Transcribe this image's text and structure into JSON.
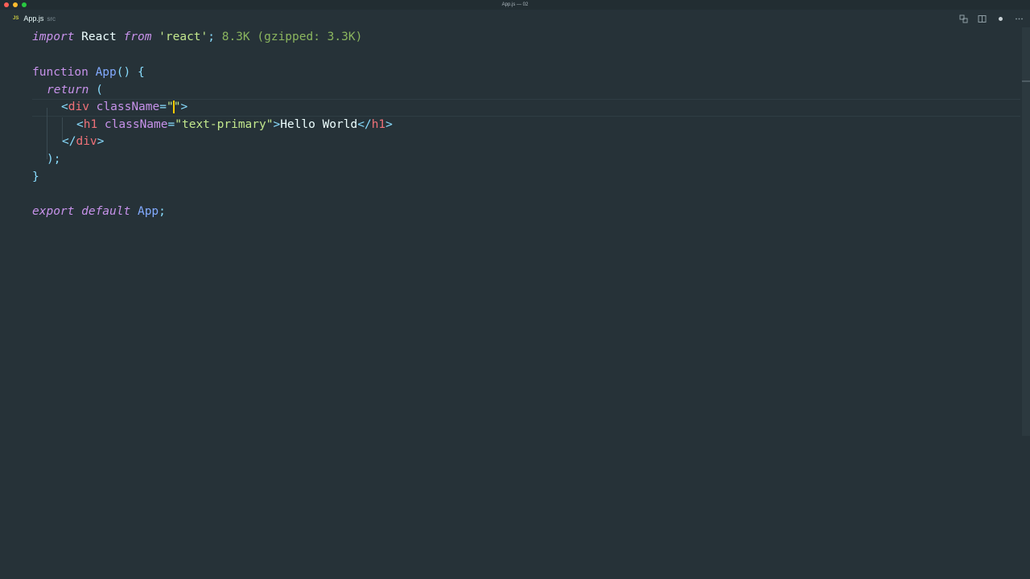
{
  "window": {
    "title": "App.js — 02"
  },
  "tab": {
    "lang_badge": "JS",
    "filename": "App.js",
    "path": "src"
  },
  "tab_actions": [
    {
      "name": "source-control-icon",
      "glyph": "⇄"
    },
    {
      "name": "split-editor-icon",
      "glyph": "◫"
    },
    {
      "name": "unsaved-dot-icon",
      "glyph": ""
    },
    {
      "name": "more-actions-icon",
      "glyph": "···"
    }
  ],
  "code": {
    "line1": {
      "import": "import",
      "react": " React ",
      "from": "from",
      "str": " 'react'",
      "semi": ";",
      "hint": " 8.3K (gzipped: 3.3K)"
    },
    "line3": {
      "function": "function",
      "name": " App",
      "paren": "()",
      "brace": " {"
    },
    "line4": {
      "return": "return",
      "paren": " ("
    },
    "line5": {
      "lt": "<",
      "tag": "div",
      "attr": " className",
      "eq": "=",
      "q1": "\"",
      "q2": "\"",
      "gt": ">"
    },
    "line6": {
      "lt": "<",
      "tag": "h1",
      "attr": " className",
      "eq": "=",
      "str": "\"text-primary\"",
      "gt": ">",
      "text": "Hello World",
      "close_lt": "</",
      "close_tag": "h1",
      "close_gt": ">"
    },
    "line7": {
      "lt": "</",
      "tag": "div",
      "gt": ">"
    },
    "line8": {
      "paren": ");"
    },
    "line9": {
      "brace": "}"
    },
    "line11": {
      "export": "export",
      "default": " default",
      "name": " App",
      "semi": ";"
    }
  },
  "colors": {
    "background": "#263238",
    "keyword": "#c792ea",
    "function": "#82aaff",
    "string": "#c3e88d",
    "tag": "#f07178",
    "cursor": "#ffcc00"
  }
}
